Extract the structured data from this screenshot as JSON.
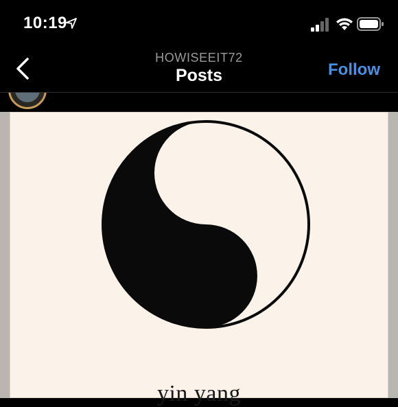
{
  "status_bar": {
    "time": "10:19",
    "icons": [
      "location-arrow-icon",
      "signal-icon",
      "wifi-icon",
      "battery-icon"
    ]
  },
  "nav": {
    "username": "HOWISEEIT72",
    "title": "Posts",
    "follow_label": "Follow",
    "back_icon": "chevron-left-icon"
  },
  "colors": {
    "background": "#000000",
    "follow_accent": "#4a90e2",
    "username_gray": "#9a9a9a",
    "paper": "#fbf3ea"
  },
  "post": {
    "image_subject": "yin-yang-symbol",
    "caption": "yin yang"
  }
}
